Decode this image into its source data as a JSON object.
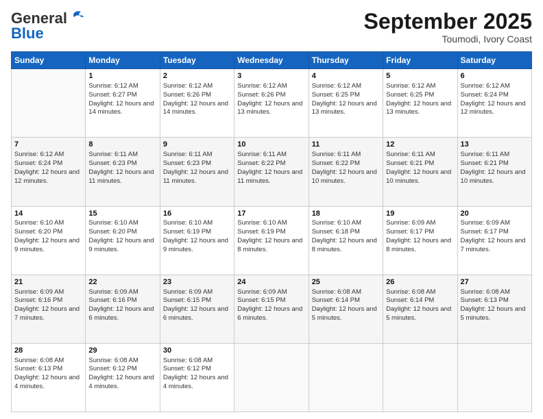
{
  "logo": {
    "general": "General",
    "blue": "Blue"
  },
  "title": "September 2025",
  "subtitle": "Toumodi, Ivory Coast",
  "days": [
    "Sunday",
    "Monday",
    "Tuesday",
    "Wednesday",
    "Thursday",
    "Friday",
    "Saturday"
  ],
  "weeks": [
    [
      {
        "day": "",
        "data": ""
      },
      {
        "day": "1",
        "data": "Sunrise: 6:12 AM\nSunset: 6:27 PM\nDaylight: 12 hours and 14 minutes."
      },
      {
        "day": "2",
        "data": "Sunrise: 6:12 AM\nSunset: 6:26 PM\nDaylight: 12 hours and 14 minutes."
      },
      {
        "day": "3",
        "data": "Sunrise: 6:12 AM\nSunset: 6:26 PM\nDaylight: 12 hours and 13 minutes."
      },
      {
        "day": "4",
        "data": "Sunrise: 6:12 AM\nSunset: 6:25 PM\nDaylight: 12 hours and 13 minutes."
      },
      {
        "day": "5",
        "data": "Sunrise: 6:12 AM\nSunset: 6:25 PM\nDaylight: 12 hours and 13 minutes."
      },
      {
        "day": "6",
        "data": "Sunrise: 6:12 AM\nSunset: 6:24 PM\nDaylight: 12 hours and 12 minutes."
      }
    ],
    [
      {
        "day": "7",
        "data": "Sunrise: 6:12 AM\nSunset: 6:24 PM\nDaylight: 12 hours and 12 minutes."
      },
      {
        "day": "8",
        "data": "Sunrise: 6:11 AM\nSunset: 6:23 PM\nDaylight: 12 hours and 11 minutes."
      },
      {
        "day": "9",
        "data": "Sunrise: 6:11 AM\nSunset: 6:23 PM\nDaylight: 12 hours and 11 minutes."
      },
      {
        "day": "10",
        "data": "Sunrise: 6:11 AM\nSunset: 6:22 PM\nDaylight: 12 hours and 11 minutes."
      },
      {
        "day": "11",
        "data": "Sunrise: 6:11 AM\nSunset: 6:22 PM\nDaylight: 12 hours and 10 minutes."
      },
      {
        "day": "12",
        "data": "Sunrise: 6:11 AM\nSunset: 6:21 PM\nDaylight: 12 hours and 10 minutes."
      },
      {
        "day": "13",
        "data": "Sunrise: 6:11 AM\nSunset: 6:21 PM\nDaylight: 12 hours and 10 minutes."
      }
    ],
    [
      {
        "day": "14",
        "data": "Sunrise: 6:10 AM\nSunset: 6:20 PM\nDaylight: 12 hours and 9 minutes."
      },
      {
        "day": "15",
        "data": "Sunrise: 6:10 AM\nSunset: 6:20 PM\nDaylight: 12 hours and 9 minutes."
      },
      {
        "day": "16",
        "data": "Sunrise: 6:10 AM\nSunset: 6:19 PM\nDaylight: 12 hours and 9 minutes."
      },
      {
        "day": "17",
        "data": "Sunrise: 6:10 AM\nSunset: 6:19 PM\nDaylight: 12 hours and 8 minutes."
      },
      {
        "day": "18",
        "data": "Sunrise: 6:10 AM\nSunset: 6:18 PM\nDaylight: 12 hours and 8 minutes."
      },
      {
        "day": "19",
        "data": "Sunrise: 6:09 AM\nSunset: 6:17 PM\nDaylight: 12 hours and 8 minutes."
      },
      {
        "day": "20",
        "data": "Sunrise: 6:09 AM\nSunset: 6:17 PM\nDaylight: 12 hours and 7 minutes."
      }
    ],
    [
      {
        "day": "21",
        "data": "Sunrise: 6:09 AM\nSunset: 6:16 PM\nDaylight: 12 hours and 7 minutes."
      },
      {
        "day": "22",
        "data": "Sunrise: 6:09 AM\nSunset: 6:16 PM\nDaylight: 12 hours and 6 minutes."
      },
      {
        "day": "23",
        "data": "Sunrise: 6:09 AM\nSunset: 6:15 PM\nDaylight: 12 hours and 6 minutes."
      },
      {
        "day": "24",
        "data": "Sunrise: 6:09 AM\nSunset: 6:15 PM\nDaylight: 12 hours and 6 minutes."
      },
      {
        "day": "25",
        "data": "Sunrise: 6:08 AM\nSunset: 6:14 PM\nDaylight: 12 hours and 5 minutes."
      },
      {
        "day": "26",
        "data": "Sunrise: 6:08 AM\nSunset: 6:14 PM\nDaylight: 12 hours and 5 minutes."
      },
      {
        "day": "27",
        "data": "Sunrise: 6:08 AM\nSunset: 6:13 PM\nDaylight: 12 hours and 5 minutes."
      }
    ],
    [
      {
        "day": "28",
        "data": "Sunrise: 6:08 AM\nSunset: 6:13 PM\nDaylight: 12 hours and 4 minutes."
      },
      {
        "day": "29",
        "data": "Sunrise: 6:08 AM\nSunset: 6:12 PM\nDaylight: 12 hours and 4 minutes."
      },
      {
        "day": "30",
        "data": "Sunrise: 6:08 AM\nSunset: 6:12 PM\nDaylight: 12 hours and 4 minutes."
      },
      {
        "day": "",
        "data": ""
      },
      {
        "day": "",
        "data": ""
      },
      {
        "day": "",
        "data": ""
      },
      {
        "day": "",
        "data": ""
      }
    ]
  ]
}
